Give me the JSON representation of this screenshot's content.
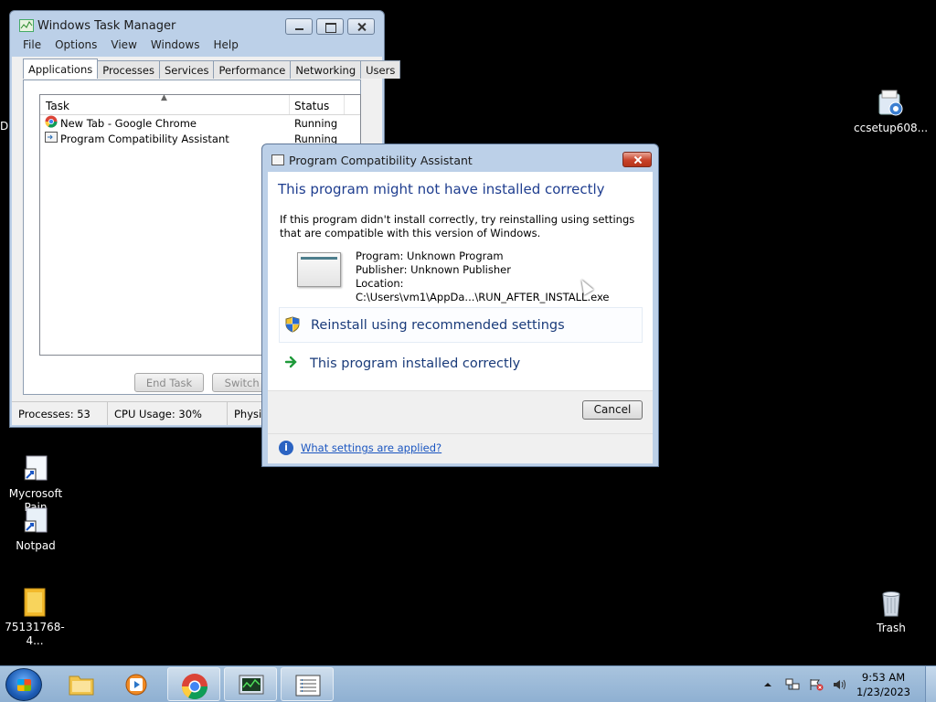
{
  "desktop": {
    "clipped_icon_label": "D",
    "icons": [
      {
        "label": "ccsetup608..."
      },
      {
        "label": "Mycrosoft\nPain"
      },
      {
        "label": "Notpad"
      },
      {
        "label": "75131768-4..."
      },
      {
        "label": "Trash"
      }
    ]
  },
  "task_manager": {
    "title": "Windows Task Manager",
    "menu": [
      "File",
      "Options",
      "View",
      "Windows",
      "Help"
    ],
    "tabs": [
      "Applications",
      "Processes",
      "Services",
      "Performance",
      "Networking",
      "Users"
    ],
    "active_tab": "Applications",
    "columns": {
      "task": "Task",
      "status": "Status"
    },
    "rows": [
      {
        "task": "New Tab - Google Chrome",
        "status": "Running",
        "icon": "chrome-icon"
      },
      {
        "task": "Program Compatibility Assistant",
        "status": "Running",
        "icon": "app-window-icon"
      }
    ],
    "buttons": {
      "end_task": "End Task",
      "switch_to": "Switch T"
    },
    "status_bar": {
      "processes": "Processes: 53",
      "cpu": "CPU Usage: 30%",
      "physical": "Physi"
    }
  },
  "compat_dialog": {
    "title": "Program Compatibility Assistant",
    "heading": "This program might not have installed correctly",
    "description": "If this program didn't install correctly, try reinstalling using settings that are compatible with this version of Windows.",
    "program": "Program: Unknown Program",
    "publisher": "Publisher: Unknown Publisher",
    "location": "Location: C:\\Users\\vm1\\AppDa...\\RUN_AFTER_INSTALL.exe",
    "option_reinstall": "Reinstall using recommended settings",
    "option_ok": "This program installed correctly",
    "cancel": "Cancel",
    "help_link": "What settings are applied?"
  },
  "taskbar": {
    "apps": [
      "explorer-icon",
      "media-player-icon",
      "chrome-icon",
      "task-manager-icon",
      "compat-assistant-icon"
    ],
    "time": "9:53 AM",
    "date": "1/23/2023",
    "tray_icons": [
      "show-hidden-icon",
      "network-icon",
      "action-center-icon",
      "volume-icon"
    ]
  },
  "colors": {
    "accent_heading": "#1e3d8f",
    "link": "#1a55c0",
    "window_frame": "#bcd0e8",
    "desktop": "#000000"
  }
}
